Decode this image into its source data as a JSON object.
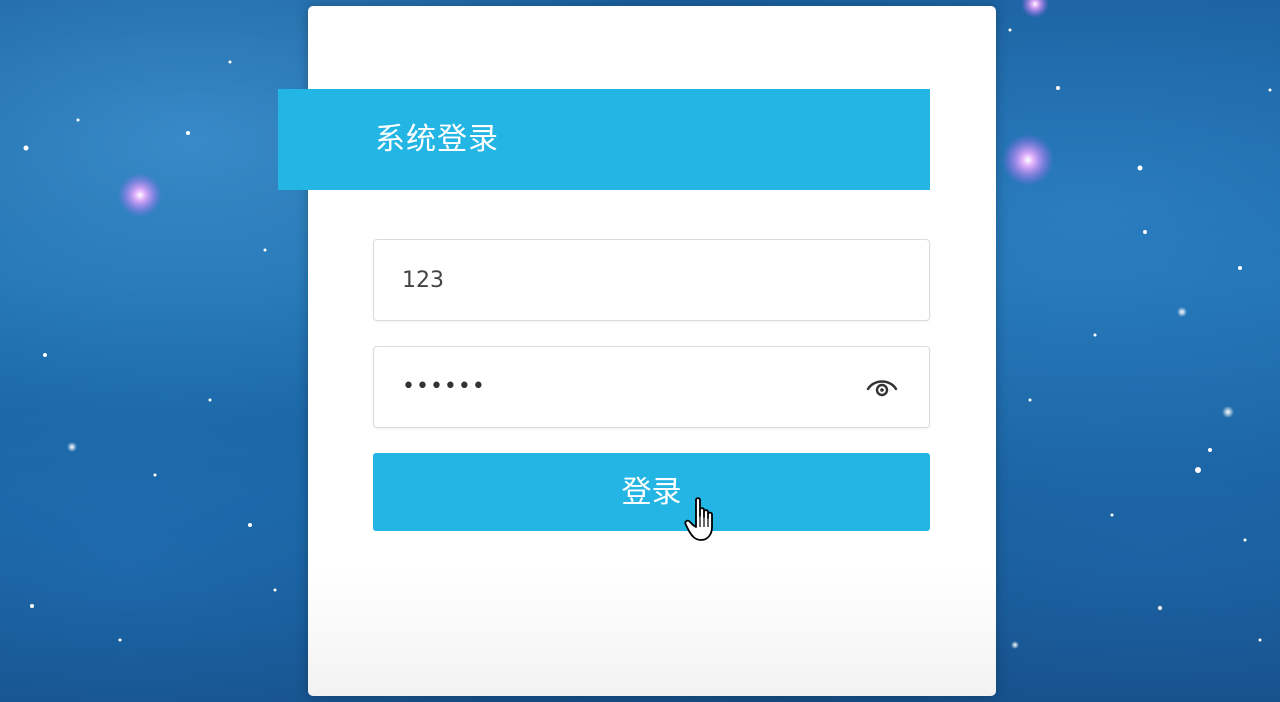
{
  "login": {
    "title": "系统登录",
    "username": {
      "value": "123"
    },
    "password": {
      "masked_value": "••••••",
      "toggle_icon": "eye-icon"
    },
    "submit_label": "登录"
  },
  "colors": {
    "accent": "#23b5e3",
    "card_bg": "#ffffff",
    "background": "#1a5f9e"
  },
  "cursor_icon": "hand-pointer-icon"
}
